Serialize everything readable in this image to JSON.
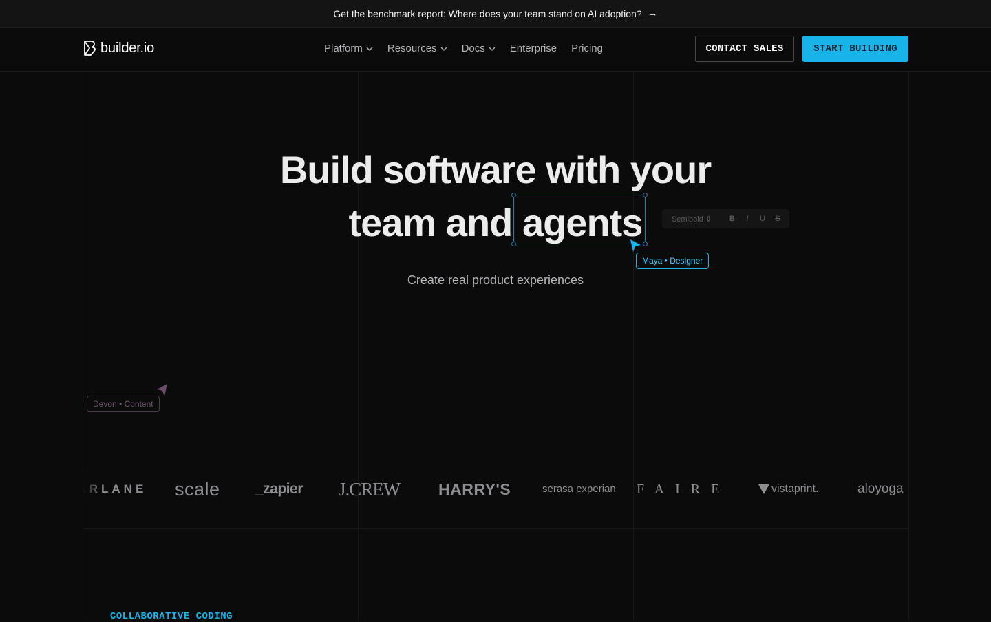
{
  "announcement": {
    "text": "Get the benchmark report: Where does your team stand on AI adoption?",
    "arrow_icon": "arrow-right-icon"
  },
  "nav": {
    "logo_text": "builder.io",
    "items": [
      {
        "label": "Platform",
        "has_dropdown": true
      },
      {
        "label": "Resources",
        "has_dropdown": true
      },
      {
        "label": "Docs",
        "has_dropdown": true
      },
      {
        "label": "Enterprise",
        "has_dropdown": false
      },
      {
        "label": "Pricing",
        "has_dropdown": false
      }
    ],
    "contact_label": "CONTACT SALES",
    "start_label": "START BUILDING"
  },
  "hero": {
    "title_line1": "Build software with your",
    "title_line2_a": "team and",
    "title_line2_b": "agents",
    "subtitle": "Create real product experiences",
    "toolbar": {
      "font_weight": "Semibold ⇕",
      "bold": "B",
      "italic": "I",
      "underline": "U",
      "strike": "S"
    },
    "cursor_maya": "Maya • Designer",
    "cursor_devon": "Devon • Content"
  },
  "logos": [
    "FARLANE",
    "scale",
    "_zapier",
    "J.CREW",
    "HARRY'S",
    "serasa experian",
    "FAIRE",
    "vistaprint.",
    "aloyoga"
  ],
  "section": {
    "label": "COLLABORATIVE CODING"
  },
  "colors": {
    "accent": "#18b4e9",
    "background": "#0b0b0c",
    "devon": "#6e566e"
  }
}
